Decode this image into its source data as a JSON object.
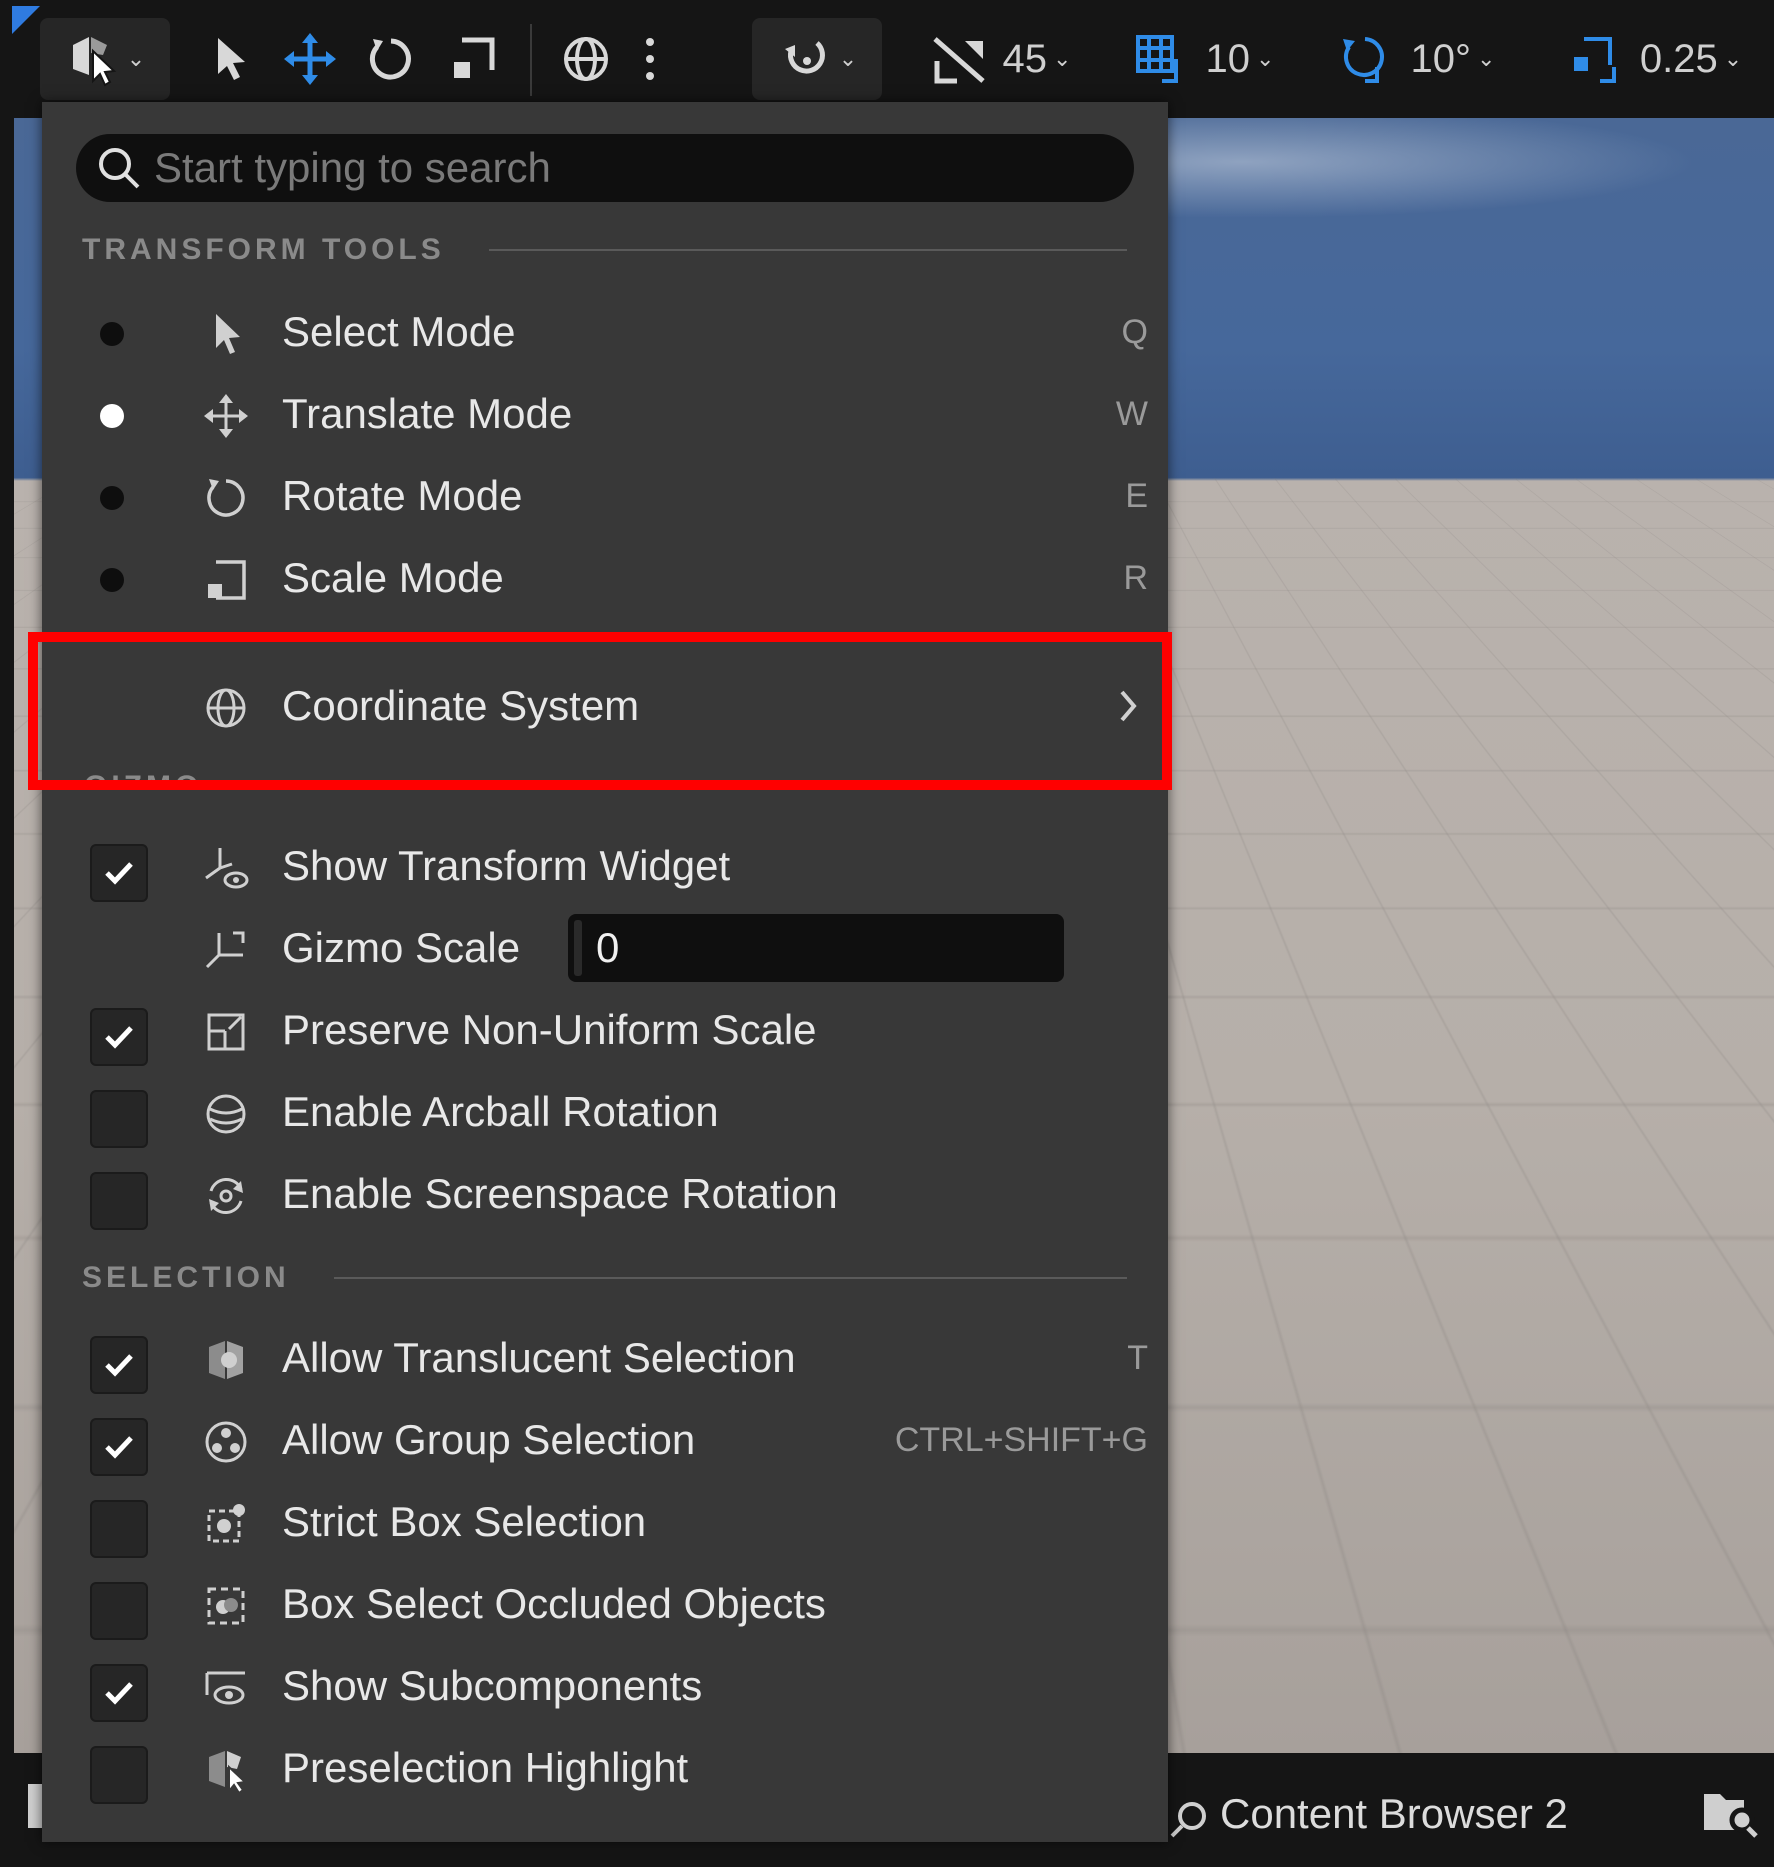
{
  "toolbar": {
    "snap_angle": "45",
    "grid_snap": "10",
    "rotation_snap": "10°",
    "scale_snap": "0.25"
  },
  "menu": {
    "search_placeholder": "Start typing to search",
    "sections": {
      "transform_tools": "TRANSFORM TOOLS",
      "gizmo": "GIZMO",
      "selection": "SELECTION"
    },
    "transform_items": [
      {
        "label": "Select Mode",
        "shortcut": "Q",
        "selected": false
      },
      {
        "label": "Translate Mode",
        "shortcut": "W",
        "selected": true
      },
      {
        "label": "Rotate Mode",
        "shortcut": "E",
        "selected": false
      },
      {
        "label": "Scale Mode",
        "shortcut": "R",
        "selected": false
      }
    ],
    "coordinate_system": "Coordinate System",
    "gizmo_items": [
      {
        "label": "Show Transform Widget",
        "checked": true
      },
      {
        "label": "Gizmo Scale",
        "value": "0"
      },
      {
        "label": "Preserve Non-Uniform Scale",
        "checked": true
      },
      {
        "label": "Enable Arcball Rotation",
        "checked": false
      },
      {
        "label": "Enable Screenspace Rotation",
        "checked": false
      }
    ],
    "selection_items": [
      {
        "label": "Allow Translucent Selection",
        "shortcut": "T",
        "checked": true
      },
      {
        "label": "Allow Group Selection",
        "shortcut": "CTRL+SHIFT+G",
        "checked": true
      },
      {
        "label": "Strict Box Selection",
        "checked": false
      },
      {
        "label": "Box Select Occluded Objects",
        "checked": false
      },
      {
        "label": "Show Subcomponents",
        "checked": true
      },
      {
        "label": "Preselection Highlight",
        "checked": false
      }
    ]
  },
  "bottom": {
    "content_browser": "Content Browser 2"
  },
  "colors": {
    "accent_blue": "#2f8ce8",
    "highlight_red": "#ff0000"
  }
}
